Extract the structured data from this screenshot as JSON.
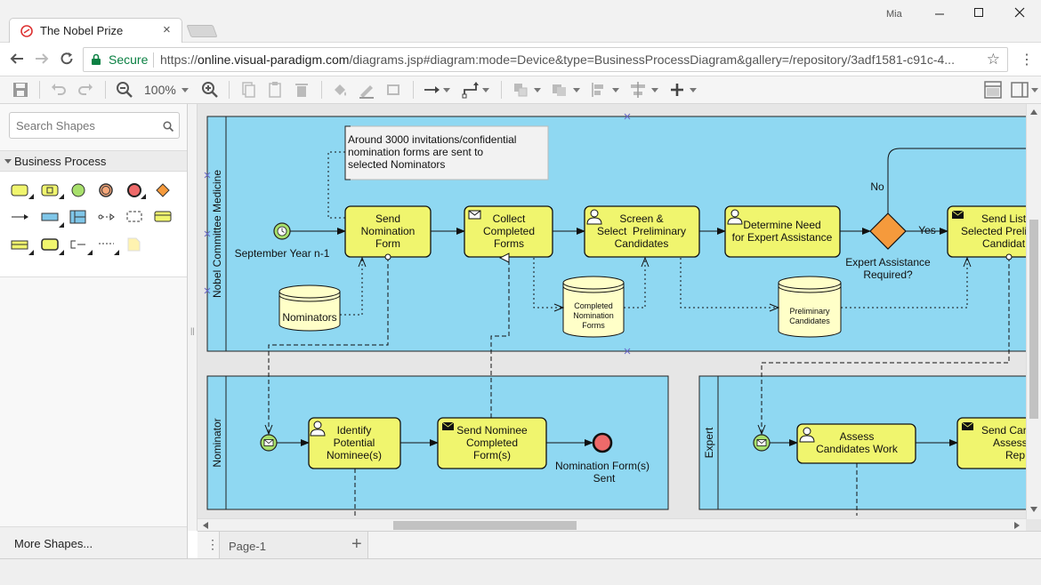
{
  "browser": {
    "tab_title": "The Nobel Prize",
    "tab_close": "×",
    "window_user": "Mia",
    "secure_label": "Secure",
    "url_scheme": "https://",
    "url_host": "online.visual-paradigm.com",
    "url_path": "/diagrams.jsp#diagram:mode=Device&type=BusinessProcessDiagram&gallery=/repository/3adf1581-c91c-4..."
  },
  "toolbar": {
    "zoom_level": "100%"
  },
  "sidebar": {
    "search_placeholder": "Search Shapes",
    "section_label": "Business Process",
    "more_shapes": "More Shapes..."
  },
  "pages": {
    "current": "Page-1",
    "add_label": "+"
  },
  "diagram": {
    "lanes": {
      "committee": "Nobel Committee Medicine",
      "nominator": "Nominator",
      "expert": "Expert"
    },
    "annotation": {
      "line1": "Around 3000 invitations/confidential",
      "line2": "nomination forms are sent to",
      "line3": "selected Nominators"
    },
    "start_label": "September Year n-1",
    "tasks": {
      "send_form": [
        "Send",
        "Nomination",
        "Form"
      ],
      "collect_forms": [
        "Collect",
        "Completed",
        "Forms"
      ],
      "screen_select": [
        "Screen &",
        "Select  Preliminary",
        "Candidates"
      ],
      "determine_need": [
        "Determine Need",
        "for Expert Assistance"
      ],
      "send_list": [
        "Send List",
        "Selected Preli",
        "Candidat"
      ],
      "identify": [
        "Identify",
        "Potential",
        "Nominee(s)"
      ],
      "send_nominee": [
        "Send Nominee",
        "Completed",
        "Form(s)"
      ],
      "assess": [
        "Assess",
        "Candidates Work"
      ],
      "send_candidates": [
        "Send Can",
        "Assess",
        "Rep"
      ]
    },
    "gateway": {
      "label1": "Expert Assistance",
      "label2": "Required?",
      "no": "No",
      "yes": "Yes"
    },
    "datastores": {
      "nominators": "Nominators",
      "completed": [
        "Completed",
        "Nomination",
        "Forms"
      ],
      "preliminary": [
        "Preliminary",
        "Candidates"
      ]
    },
    "end_label": [
      "Nomination Form(s)",
      "Sent"
    ],
    "colors": {
      "pool": "#8fd8f2",
      "task": "#f0f56e",
      "datastore": "#ffffc8",
      "gateway": "#f59a3c",
      "end_event": "#ee6a6a",
      "start_event": "#a8e06c"
    }
  }
}
